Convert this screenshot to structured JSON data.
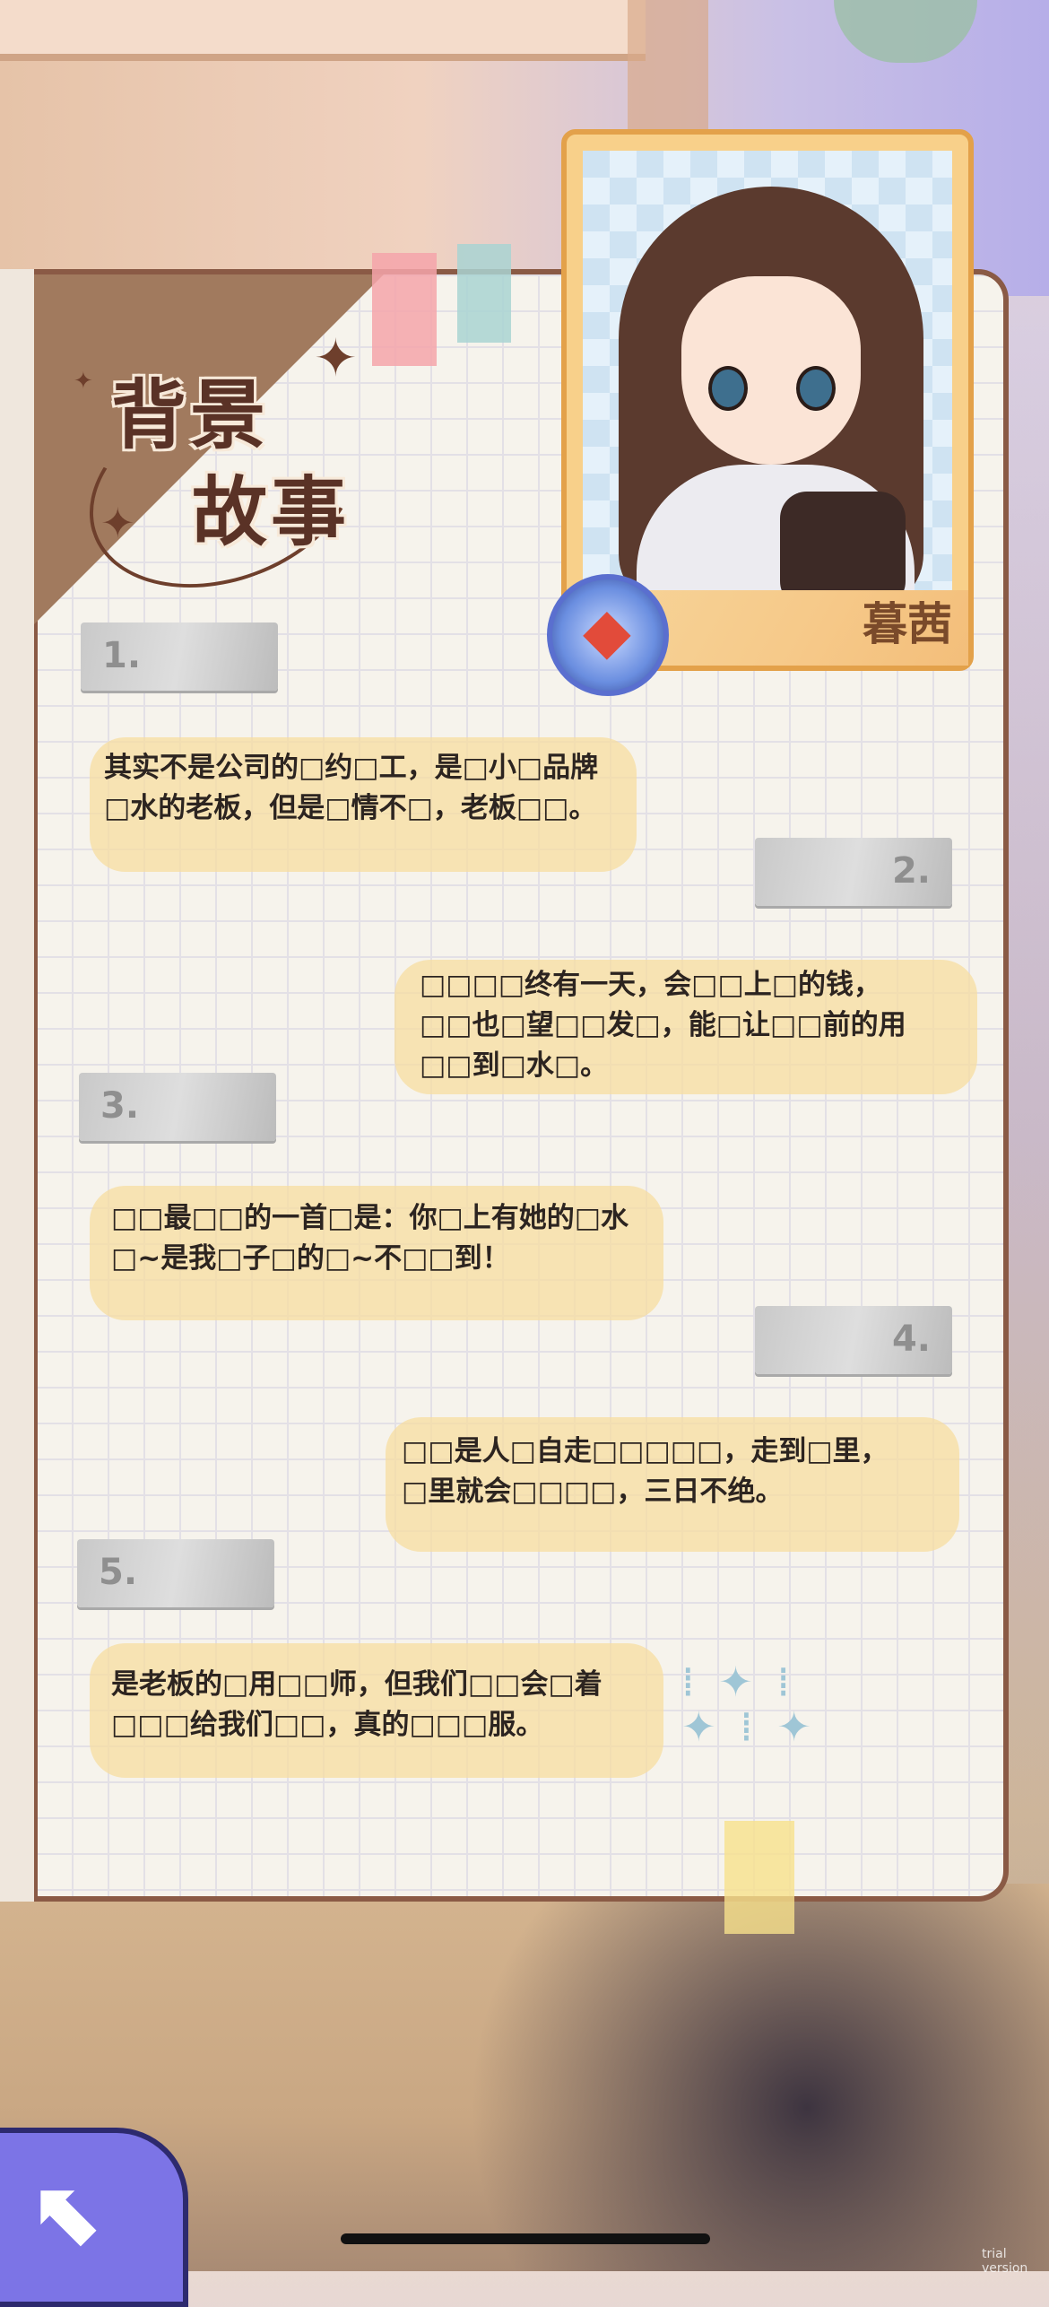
{
  "title": {
    "line1": "背景",
    "line2": "故事"
  },
  "character": {
    "name": "暮茜"
  },
  "entries": [
    {
      "label": "1.",
      "text": "其实不是公司的□约□工，是□小□品牌□水的老板，但是□情不□，老板□□。"
    },
    {
      "label": "2.",
      "text": "□□□□终有一天，会□□上□的钱，□□也□望□□发□，能□让□□前的用□□到□水□。"
    },
    {
      "label": "3.",
      "text": "□□最□□的一首□是：你□上有她的□水□~是我□子□的□~不□□到！"
    },
    {
      "label": "4.",
      "text": "□□是人□自走□□□□□，走到□里，□里就会□□□□，三日不绝。"
    },
    {
      "label": "5.",
      "text": "是老板的□用□□师，但我们□□会□着□□□给我们□□，真的□□□服。"
    }
  ],
  "controls": {
    "back_icon": "back-arrow-icon"
  },
  "watermark": "trial version",
  "colors": {
    "notebook_border": "#8a5a45",
    "highlight": "#f7dda0",
    "frame": "#e3a14a",
    "back_button": "#7c74e6"
  }
}
